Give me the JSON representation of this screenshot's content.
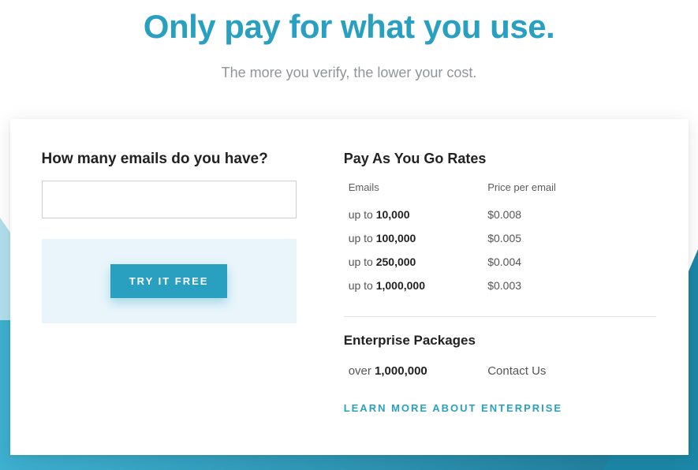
{
  "header": {
    "headline": "Only pay for what you use.",
    "subheadline": "The more you verify, the lower your cost."
  },
  "left": {
    "title": "How many emails do you have?",
    "input_value": "",
    "cta_label": "TRY IT FREE"
  },
  "right": {
    "payg_title": "Pay As You Go Rates",
    "header_emails": "Emails",
    "header_price": "Price per email",
    "rates": [
      {
        "prefix": "up to ",
        "qty": "10,000",
        "price": "$0.008"
      },
      {
        "prefix": "up to ",
        "qty": "100,000",
        "price": "$0.005"
      },
      {
        "prefix": "up to ",
        "qty": "250,000",
        "price": "$0.004"
      },
      {
        "prefix": "up to ",
        "qty": "1,000,000",
        "price": "$0.003"
      }
    ],
    "enterprise_title": "Enterprise Packages",
    "enterprise_row": {
      "prefix": "over ",
      "qty": "1,000,000",
      "contact": "Contact Us"
    },
    "learn_more_label": "LEARN MORE ABOUT ENTERPRISE"
  },
  "colors": {
    "accent": "#2aa0c0",
    "muted": "#91959b"
  }
}
